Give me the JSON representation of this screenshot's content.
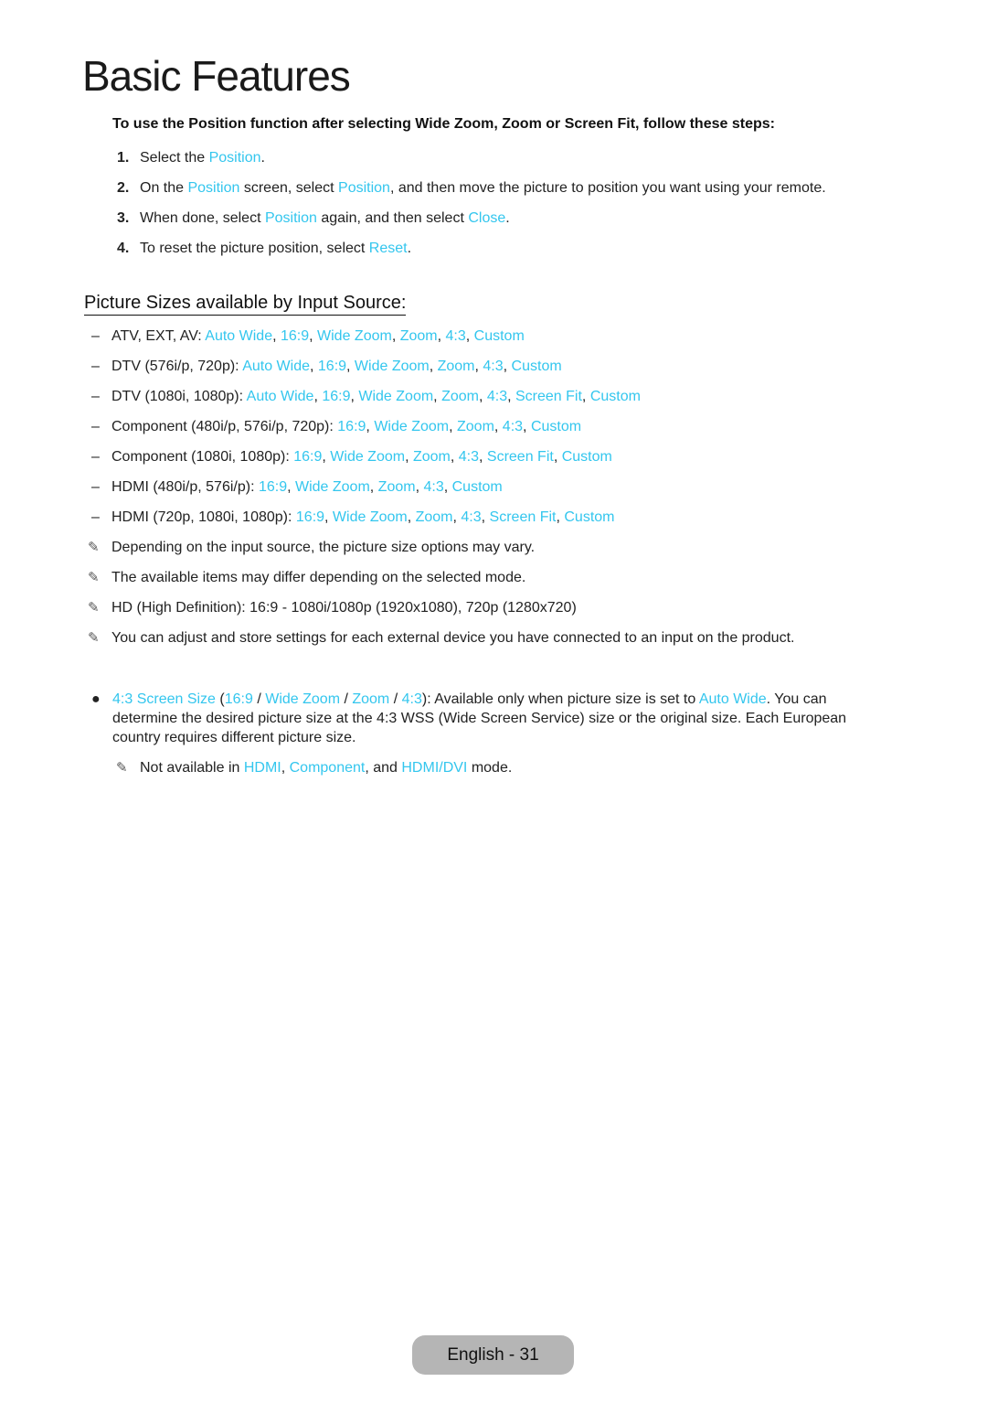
{
  "page": {
    "title": "Basic Features",
    "intro": "To use the Position function after selecting Wide Zoom, Zoom or Screen Fit, follow these steps:",
    "steps": [
      {
        "num": "1.",
        "parts": [
          {
            "t": "Select the "
          },
          {
            "t": "Position",
            "link": true
          },
          {
            "t": "."
          }
        ]
      },
      {
        "num": "2.",
        "parts": [
          {
            "t": "On the "
          },
          {
            "t": "Position",
            "link": true
          },
          {
            "t": " screen, select "
          },
          {
            "t": "Position",
            "link": true
          },
          {
            "t": ", and then move the picture to position you want using your remote."
          }
        ]
      },
      {
        "num": "3.",
        "parts": [
          {
            "t": "When done, select "
          },
          {
            "t": "Position",
            "link": true
          },
          {
            "t": " again, and then select "
          },
          {
            "t": "Close",
            "link": true
          },
          {
            "t": "."
          }
        ]
      },
      {
        "num": "4.",
        "parts": [
          {
            "t": "To reset the picture position, select "
          },
          {
            "t": "Reset",
            "link": true
          },
          {
            "t": "."
          }
        ]
      }
    ],
    "section_heading": "Picture Sizes available by Input Source:",
    "sizes": [
      {
        "source": "ATV, EXT, AV: ",
        "options": [
          "Auto Wide",
          "16:9",
          "Wide Zoom",
          "Zoom",
          "4:3",
          "Custom"
        ]
      },
      {
        "source": "DTV (576i/p, 720p): ",
        "options": [
          "Auto Wide",
          "16:9",
          "Wide Zoom",
          "Zoom",
          "4:3",
          "Custom"
        ]
      },
      {
        "source": "DTV (1080i, 1080p): ",
        "options": [
          "Auto Wide",
          "16:9",
          "Wide Zoom",
          "Zoom",
          "4:3",
          "Screen Fit",
          "Custom"
        ]
      },
      {
        "source": "Component (480i/p, 576i/p, 720p): ",
        "options": [
          "16:9",
          "Wide Zoom",
          "Zoom",
          "4:3",
          "Custom"
        ]
      },
      {
        "source": "Component (1080i, 1080p): ",
        "options": [
          "16:9",
          "Wide Zoom",
          "Zoom",
          "4:3",
          "Screen Fit",
          "Custom"
        ]
      },
      {
        "source": "HDMI (480i/p, 576i/p): ",
        "options": [
          "16:9",
          "Wide Zoom",
          "Zoom",
          "4:3",
          "Custom"
        ]
      },
      {
        "source": "HDMI (720p, 1080i, 1080p): ",
        "options": [
          "16:9",
          "Wide Zoom",
          "Zoom",
          "4:3",
          "Screen Fit",
          "Custom"
        ]
      }
    ],
    "notes": [
      "Depending on the input source, the picture size options may vary.",
      "The available items may differ depending on the selected mode.",
      "HD (High Definition): 16:9 - 1080i/1080p (1920x1080), 720p (1280x720)",
      "You can adjust and store settings for each external device you have connected to an input on the product."
    ],
    "bullet": {
      "parts": [
        {
          "t": "4:3 Screen Size",
          "link": true
        },
        {
          "t": " ("
        },
        {
          "t": "16:9",
          "link": true
        },
        {
          "t": " / "
        },
        {
          "t": "Wide Zoom",
          "link": true
        },
        {
          "t": " / "
        },
        {
          "t": "Zoom",
          "link": true
        },
        {
          "t": " / "
        },
        {
          "t": "4:3",
          "link": true
        },
        {
          "t": "): Available only when picture size is set to "
        },
        {
          "t": "Auto Wide",
          "link": true
        },
        {
          "t": ". You can determine the desired picture size at the 4:3 WSS (Wide Screen Service) size or the original size. Each European country requires different picture size."
        }
      ]
    },
    "subnote": {
      "parts": [
        {
          "t": "Not available in "
        },
        {
          "t": "HDMI",
          "link": true
        },
        {
          "t": ", "
        },
        {
          "t": "Component",
          "link": true
        },
        {
          "t": ", and "
        },
        {
          "t": "HDMI/DVI",
          "link": true
        },
        {
          "t": " mode."
        }
      ]
    },
    "footer": "English - 31",
    "icons": {
      "note": "pencil-note-icon",
      "bullet": "bullet-dot-icon",
      "dash": "dash-icon"
    },
    "colors": {
      "link": "#33c6ee",
      "footer_bg": "#b5b5b5"
    }
  }
}
